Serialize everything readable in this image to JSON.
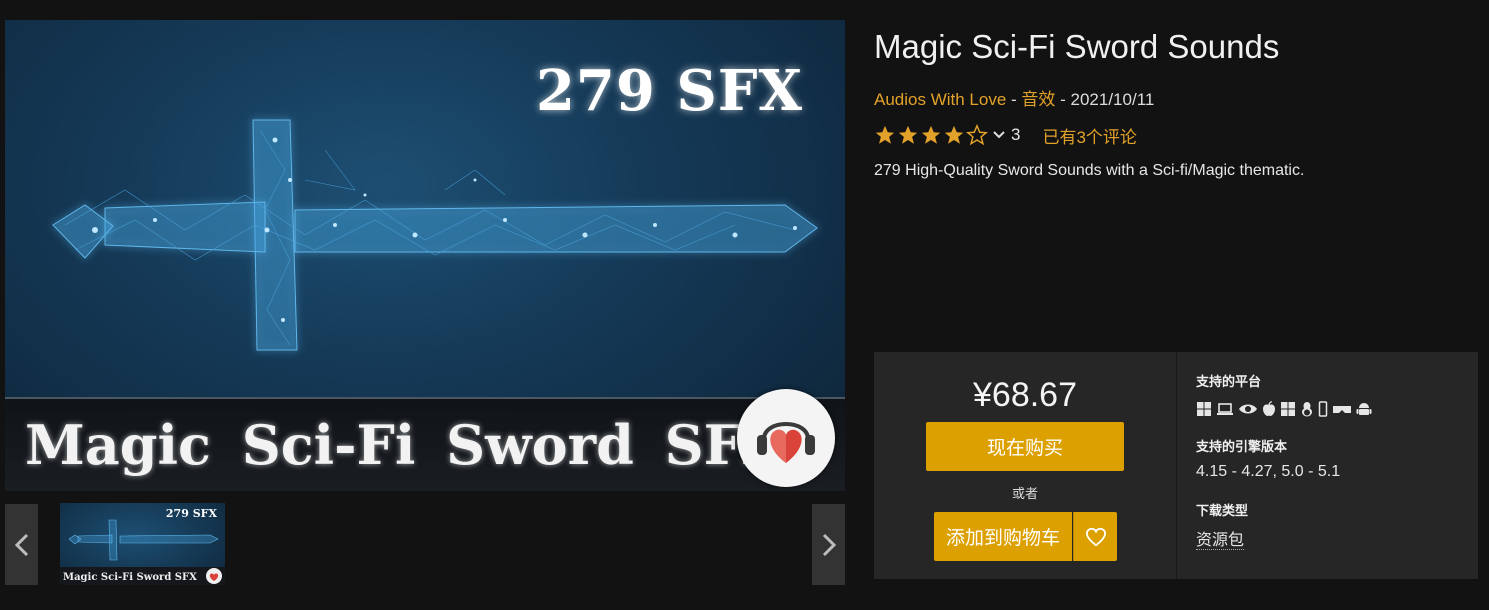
{
  "hero": {
    "badge_text": "279 SFX",
    "banner_text": "Magic  Sci-Fi  Sword  SFX"
  },
  "thumbnails": [
    {
      "badge_text": "279 SFX",
      "banner_text": "Magic  Sci-Fi  Sword  SFX"
    }
  ],
  "product": {
    "title": "Magic Sci-Fi Sword Sounds",
    "seller": "Audios With Love",
    "separator": " - ",
    "category": "音效",
    "date": "2021/10/11",
    "rating": {
      "stars": 4,
      "max": 5,
      "count": "3",
      "reviews_link": "已有3个评论"
    },
    "description": "279 High-Quality Sword Sounds with a Sci-fi/Magic thematic."
  },
  "purchase": {
    "price": "¥68.67",
    "buy_now": "现在购买",
    "or": "或者",
    "add_to_cart": "添加到购物车"
  },
  "specs": {
    "platforms_label": "支持的平台",
    "platform_icons": [
      "windows-icon",
      "mac-laptop-icon",
      "vr-eye-icon",
      "apple-icon",
      "windows-icon",
      "linux-icon",
      "mobile-icon",
      "vr-headset-icon",
      "android-icon"
    ],
    "engine_label": "支持的引擎版本",
    "engine_versions": "4.15 - 4.27, 5.0 - 5.1",
    "download_label": "下载类型",
    "download_type": "资源包"
  },
  "colors": {
    "accent": "#dca000",
    "link": "#e2a22a",
    "background": "#121212",
    "panel": "#262626"
  }
}
